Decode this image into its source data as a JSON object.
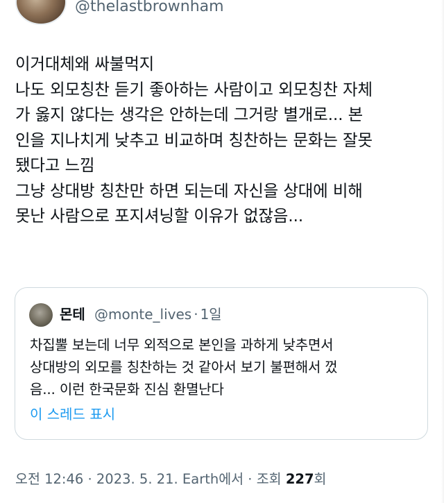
{
  "author": {
    "handle": "@thelastbrownham"
  },
  "tweet": {
    "lines": [
      "이거대체왜 싸불먹지",
      "나도 외모칭찬 듣기 좋아하는 사람이고 외모칭찬 자체",
      "가 옳지 않다는 생각은 안하는데 그거랑 별개로... 본",
      "인을 지나치게 낮추고 비교하며 칭찬하는 문화는 잘못",
      "됐다고 느낌",
      "그냥 상대방 칭찬만 하면 되는데 자신을 상대에 비해",
      "못난 사람으로 포지셔닝할 이유가 없잖음..."
    ]
  },
  "quote": {
    "name": "몬테",
    "handle": "@monte_lives",
    "separator": "·",
    "time": "1일",
    "lines": [
      "차집뿔 보는데 너무 외적으로 본인을 과하게 낮추면서",
      "상대방의 외모를 칭찬하는 것 같아서 보기 불편해서 껐",
      "음... 이런 한국문화 진심 환멸난다"
    ],
    "show_thread": "이 스레드 표시"
  },
  "footer": {
    "time": "오전 12:46",
    "sep1": " · ",
    "date": "2023. 5. 21.",
    "source": " Earth에서",
    "sep2": " · ",
    "views_label": "조회 ",
    "views_count": "227",
    "views_suffix": "회"
  },
  "colors": {
    "text": "#0f1419",
    "secondary": "#536471",
    "link": "#1d9bf0",
    "border": "#cfd9de"
  }
}
